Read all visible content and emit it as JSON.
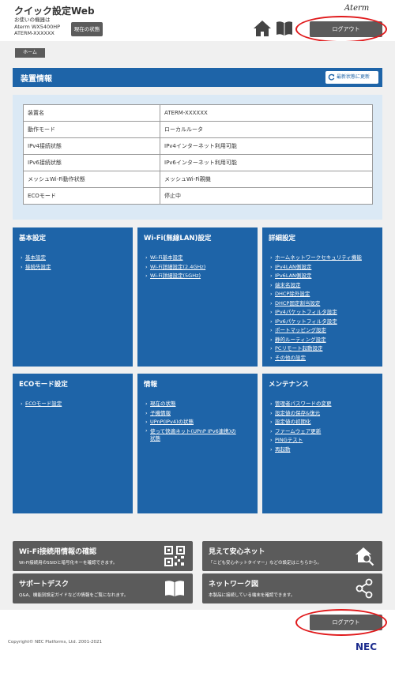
{
  "header": {
    "app_title": "クイック設定Web",
    "device_lines": [
      "お使いの機器は",
      "Aterm WX5400HP",
      "ATERM-XXXXXX"
    ],
    "status_button": "現在の状態",
    "brand": "Aterm",
    "logout_top": "ログアウト"
  },
  "breadcrumb": {
    "home": "ホーム"
  },
  "section": {
    "title": "装置情報",
    "refresh_label": "最新状態に更新"
  },
  "device_info": {
    "rows": [
      {
        "key": "装置名",
        "value": "ATERM-XXXXXX"
      },
      {
        "key": "動作モード",
        "value": "ローカルルータ"
      },
      {
        "key": "IPv4接続状態",
        "value": "IPv4インターネット利用可能"
      },
      {
        "key": "IPv6接続状態",
        "value": "IPv6インターネット利用可能"
      },
      {
        "key": "メッシュWi-Fi動作状態",
        "value": "メッシュWi-Fi親機"
      },
      {
        "key": "ECOモード",
        "value": "停止中"
      }
    ]
  },
  "cards": [
    {
      "title": "基本設定",
      "links": [
        "基本設定",
        "接続先設定"
      ]
    },
    {
      "title": "Wi-Fi(無線LAN)設定",
      "links": [
        "Wi-Fi基本設定",
        "Wi-Fi詳細設定(2.4GHz)",
        "Wi-Fi詳細設定(5GHz)"
      ]
    },
    {
      "title": "詳細設定",
      "links": [
        "ホームネットワークセキュリティ機能",
        "IPv4LAN側設定",
        "IPv6LAN側設定",
        "端末名設定",
        "DHCP除外設定",
        "DHCP固定割当設定",
        "IPv4パケットフィルタ設定",
        "IPv6パケットフィルタ設定",
        "ポートマッピング設定",
        "静的ルーティング設定",
        "PCリモート起動設定",
        "その他の設定"
      ]
    },
    {
      "title": "ECOモード設定",
      "links": [
        "ECOモード設定"
      ]
    },
    {
      "title": "情報",
      "links": [
        "現在の状態",
        "子機情報",
        "UPnP(IPv4)の状態",
        "使って快適ネット(UPnP IPv6連携)の",
        "状態"
      ]
    },
    {
      "title": "メンテナンス",
      "links": [
        "管理者パスワードの変更",
        "設定値の保存&復元",
        "設定値の初期化",
        "ファームウェア更新",
        "PINGテスト",
        "再起動"
      ]
    }
  ],
  "tiles": [
    {
      "title": "Wi-Fi接続用情報の確認",
      "sub": "Wi-Fi接続用のSSIDと暗号化キーを確認できます。",
      "icon": "qr-code-icon"
    },
    {
      "title": "見えて安心ネット",
      "sub": "「こども安心ネットタイマー」などの設定はこちらから。",
      "icon": "house-search-icon"
    },
    {
      "title": "サポートデスク",
      "sub": "Q&A、機能別設定ガイドなどの情報をご覧になれます。",
      "icon": "book-icon"
    },
    {
      "title": "ネットワーク図",
      "sub": "本製品に接続している端末を確認できます。",
      "icon": "network-icon"
    }
  ],
  "footer": {
    "logout_bottom": "ログアウト",
    "copyright": "Copyright© NEC Platforms, Ltd. 2001-2021",
    "nec": "NEC"
  },
  "colors": {
    "primary_blue": "#1e64a8",
    "dark_gray": "#5b5b5b",
    "highlight_red": "#e0191b",
    "panel_light": "#dbe9f5"
  }
}
